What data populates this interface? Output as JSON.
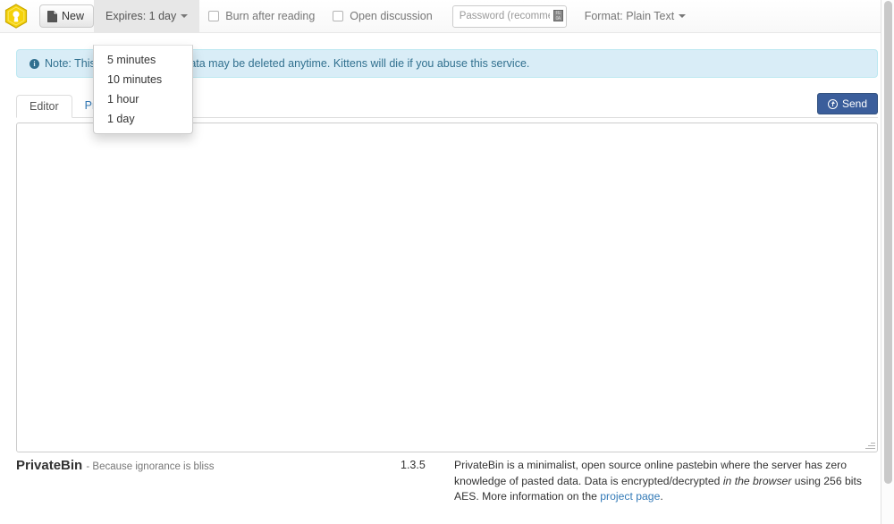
{
  "app": {
    "name": "PrivateBin",
    "logo_icon": "hexagon-keyhole-logo"
  },
  "navbar": {
    "new_button": {
      "label": "New",
      "icon": "file-document-icon"
    },
    "expires": {
      "label": "Expires: 1 day",
      "caret_icon": "caret-down-icon",
      "options": [
        "5 minutes",
        "10 minutes",
        "1 hour",
        "1 day"
      ]
    },
    "burn_after_reading": {
      "label": "Burn after reading",
      "checked": false
    },
    "open_discussion": {
      "label": "Open discussion",
      "checked": false
    },
    "password": {
      "placeholder": "Password (recommended)",
      "value": "",
      "icon": "key-glyph-icon"
    },
    "format": {
      "label": "Format: Plain Text",
      "caret_icon": "caret-down-icon"
    }
  },
  "alert": {
    "icon": "info-circle-icon",
    "info_char": "i",
    "text": "Note: This is a test service: Data may be deleted anytime. Kittens will die if you abuse this service."
  },
  "tabs": {
    "editor": "Editor",
    "preview": "Preview"
  },
  "send_button": {
    "label": "Send",
    "icon": "upload-circle-icon"
  },
  "editor": {
    "value": "",
    "placeholder": ""
  },
  "footer": {
    "brand": "PrivateBin",
    "slogan": "- Because ignorance is bliss",
    "version": "1.3.5",
    "description_part1": "PrivateBin is a minimalist, open source online pastebin where the server has zero knowledge of pasted data. Data is encrypted/decrypted ",
    "description_italic": "in the browser",
    "description_part2": " using 256 bits AES. More information on the ",
    "description_link": "project page",
    "description_end": "."
  },
  "colors": {
    "brand_yellow": "#f5d20a",
    "alert_bg": "#d9edf7",
    "alert_border": "#bce8f1",
    "alert_text": "#31708f",
    "send_blue": "#3b5e9b",
    "link_blue": "#337ab7",
    "navbar_bg": "#f8f8f8"
  }
}
